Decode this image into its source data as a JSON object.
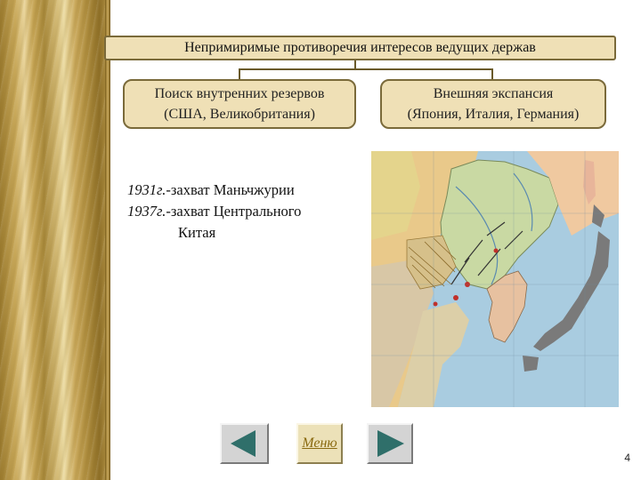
{
  "title": "Непримиримые противоречия интересов ведущих держав",
  "left_box": {
    "line1": "Поиск внутренних резервов",
    "line2": "(США, Великобритания)"
  },
  "right_box": {
    "line1": "Внешняя экспансия",
    "line2": "(Япония, Италия, Германия)"
  },
  "events": [
    {
      "year": "1931г.",
      "text": "-захват Маньчжурии"
    },
    {
      "year": "1937г.",
      "text": "-захват Центрального"
    },
    {
      "year": "",
      "text": "Китая"
    }
  ],
  "map_icon": "map-of-manchuria-and-japan",
  "nav": {
    "prev_icon": "left-arrow-icon",
    "menu_label": "Меню",
    "next_icon": "right-arrow-icon"
  },
  "page_number": "4",
  "colors": {
    "box_fill": "#efe0b6",
    "box_border": "#7a6a3a",
    "band_gold": "#c9a95a",
    "menu_text": "#8a6a10"
  }
}
